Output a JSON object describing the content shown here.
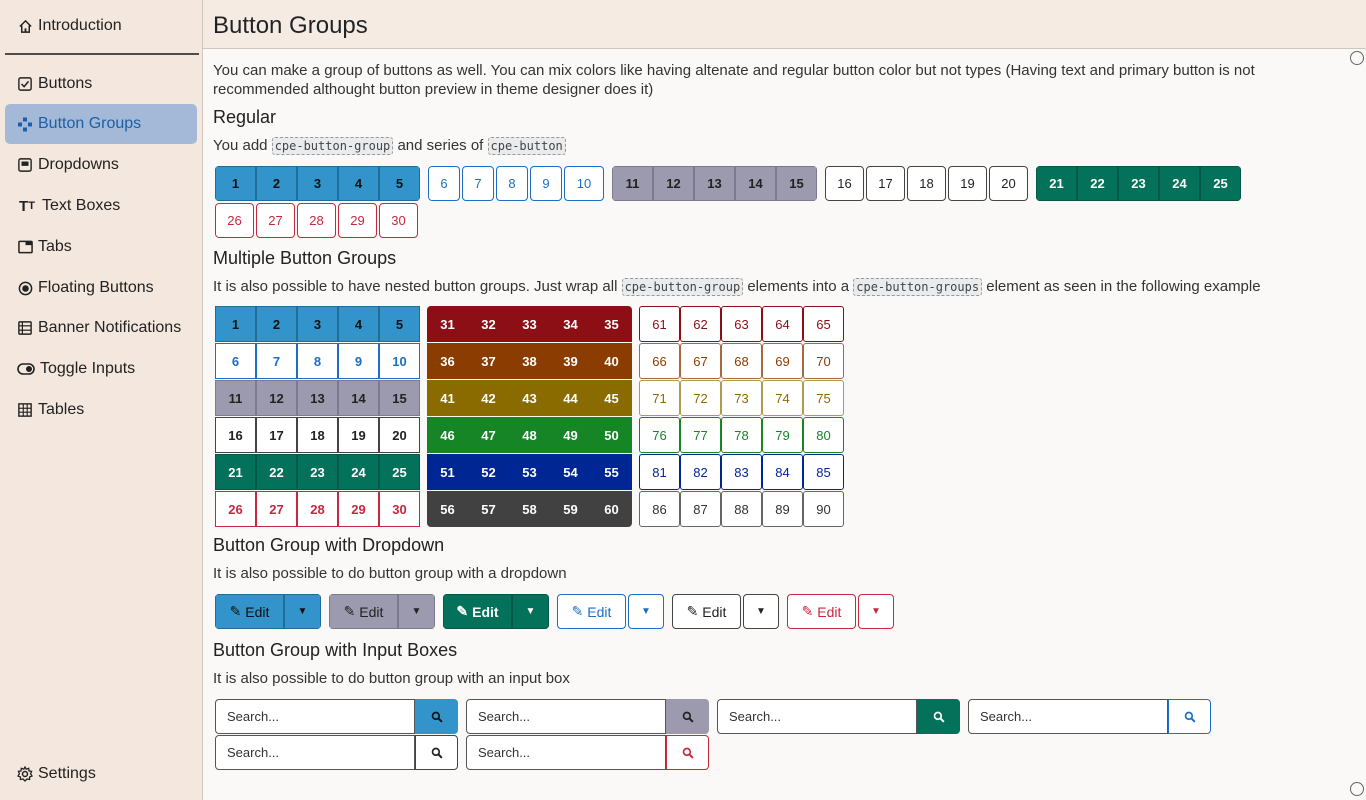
{
  "sidebar": {
    "items": [
      {
        "label": "Introduction",
        "icon": "home-icon"
      },
      {
        "label": "Buttons",
        "icon": "checkbox-icon"
      },
      {
        "label": "Button Groups",
        "icon": "gamepad-icon"
      },
      {
        "label": "Dropdowns",
        "icon": "dropdown-icon"
      },
      {
        "label": "Text Boxes",
        "icon": "text-icon"
      },
      {
        "label": "Tabs",
        "icon": "tabs-icon"
      },
      {
        "label": "Floating Buttons",
        "icon": "record-icon"
      },
      {
        "label": "Banner Notifications",
        "icon": "list-icon"
      },
      {
        "label": "Toggle Inputs",
        "icon": "toggle-icon"
      },
      {
        "label": "Tables",
        "icon": "table-icon"
      }
    ],
    "settings": "Settings"
  },
  "header": {
    "title": "Button Groups"
  },
  "intro": "You can make a group of buttons as well. You can mix colors like having altenate and regular button color but not types (Having text and primary button is not recommended althought button preview in theme designer does it)",
  "regular": {
    "title": "Regular",
    "text_a": "You add",
    "code_a": "cpe-button-group",
    "text_b": "and series of",
    "code_b": "cpe-button"
  },
  "multiple": {
    "title": "Multiple Button Groups",
    "text_a": "It is also possible to have nested button groups. Just wrap all",
    "code_a": "cpe-button-group",
    "text_b": "elements into a",
    "code_b": "cpe-button-groups",
    "text_c": "element as seen in the following example"
  },
  "dropdown": {
    "title": "Button Group with Dropdown",
    "text": "It is also possible to do button group with a dropdown",
    "edit_label": "Edit"
  },
  "inputs": {
    "title": "Button Group with Input Boxes",
    "text": "It is also possible to do button group with an input box",
    "placeholder": "Search..."
  },
  "colors": {
    "accent": "#3394cc",
    "gray": "#9b9aae",
    "green": "#04715a",
    "red": "#c8283d",
    "sidebar_active": "#a4b9d7"
  }
}
